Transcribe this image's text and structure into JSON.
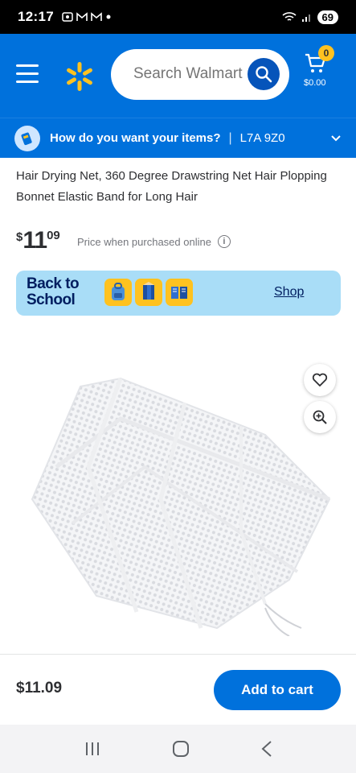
{
  "status": {
    "time": "12:17",
    "battery": "69"
  },
  "header": {
    "search_placeholder": "Search Walmart",
    "cart_count": "0",
    "cart_total": "$0.00"
  },
  "delivery": {
    "question": "How do you want your items?",
    "separator": "|",
    "zip": "L7A 9Z0"
  },
  "product": {
    "title": "Hair Drying Net, 360 Degree Drawstring Net Hair Plopping Bonnet Elastic Band for Long Hair",
    "price_dollar": "$",
    "price_whole": "11",
    "price_cents": "09",
    "price_note": "Price when purchased online",
    "info_symbol": "i"
  },
  "banner": {
    "title_line1": "Back to",
    "title_line2": "School",
    "link": "Shop"
  },
  "footer": {
    "price": "$11.09",
    "add_to_cart": "Add to cart"
  },
  "colors": {
    "brand_blue": "#0071dc",
    "spark_yellow": "#ffc220",
    "banner_bg": "#a9ddf7"
  }
}
